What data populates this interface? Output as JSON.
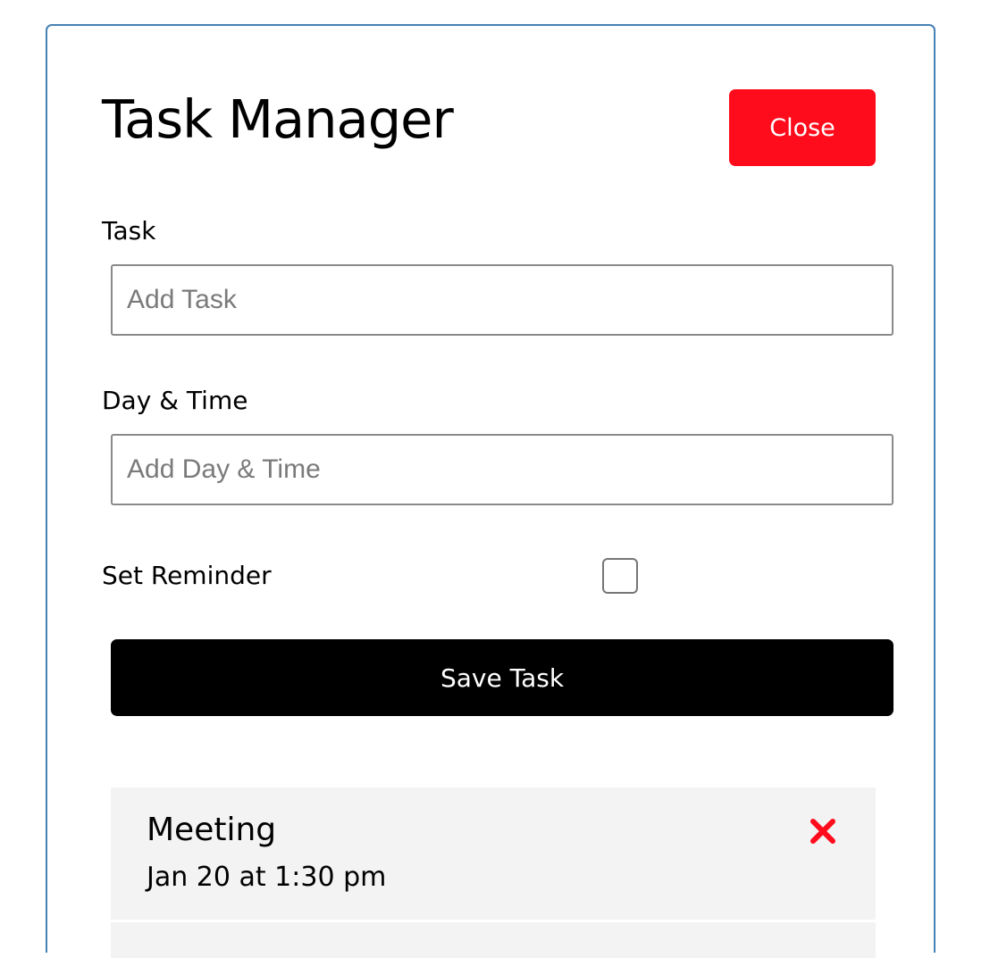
{
  "header": {
    "title": "Task Manager",
    "close_label": "Close"
  },
  "form": {
    "task_label": "Task",
    "task_placeholder": "Add Task",
    "task_value": "",
    "day_label": "Day & Time",
    "day_placeholder": "Add Day & Time",
    "day_value": "",
    "reminder_label": "Set Reminder",
    "reminder_checked": false,
    "save_label": "Save Task"
  },
  "tasks": [
    {
      "name": "Meeting",
      "time": "Jan 20 at 1:30 pm",
      "delete_icon": "close-x-icon"
    }
  ],
  "colors": {
    "close_button": "#ff0c1c",
    "save_button": "#000000",
    "container_border": "#4682b4",
    "task_background": "#f3f3f3",
    "delete_icon": "#ff0c1c"
  }
}
